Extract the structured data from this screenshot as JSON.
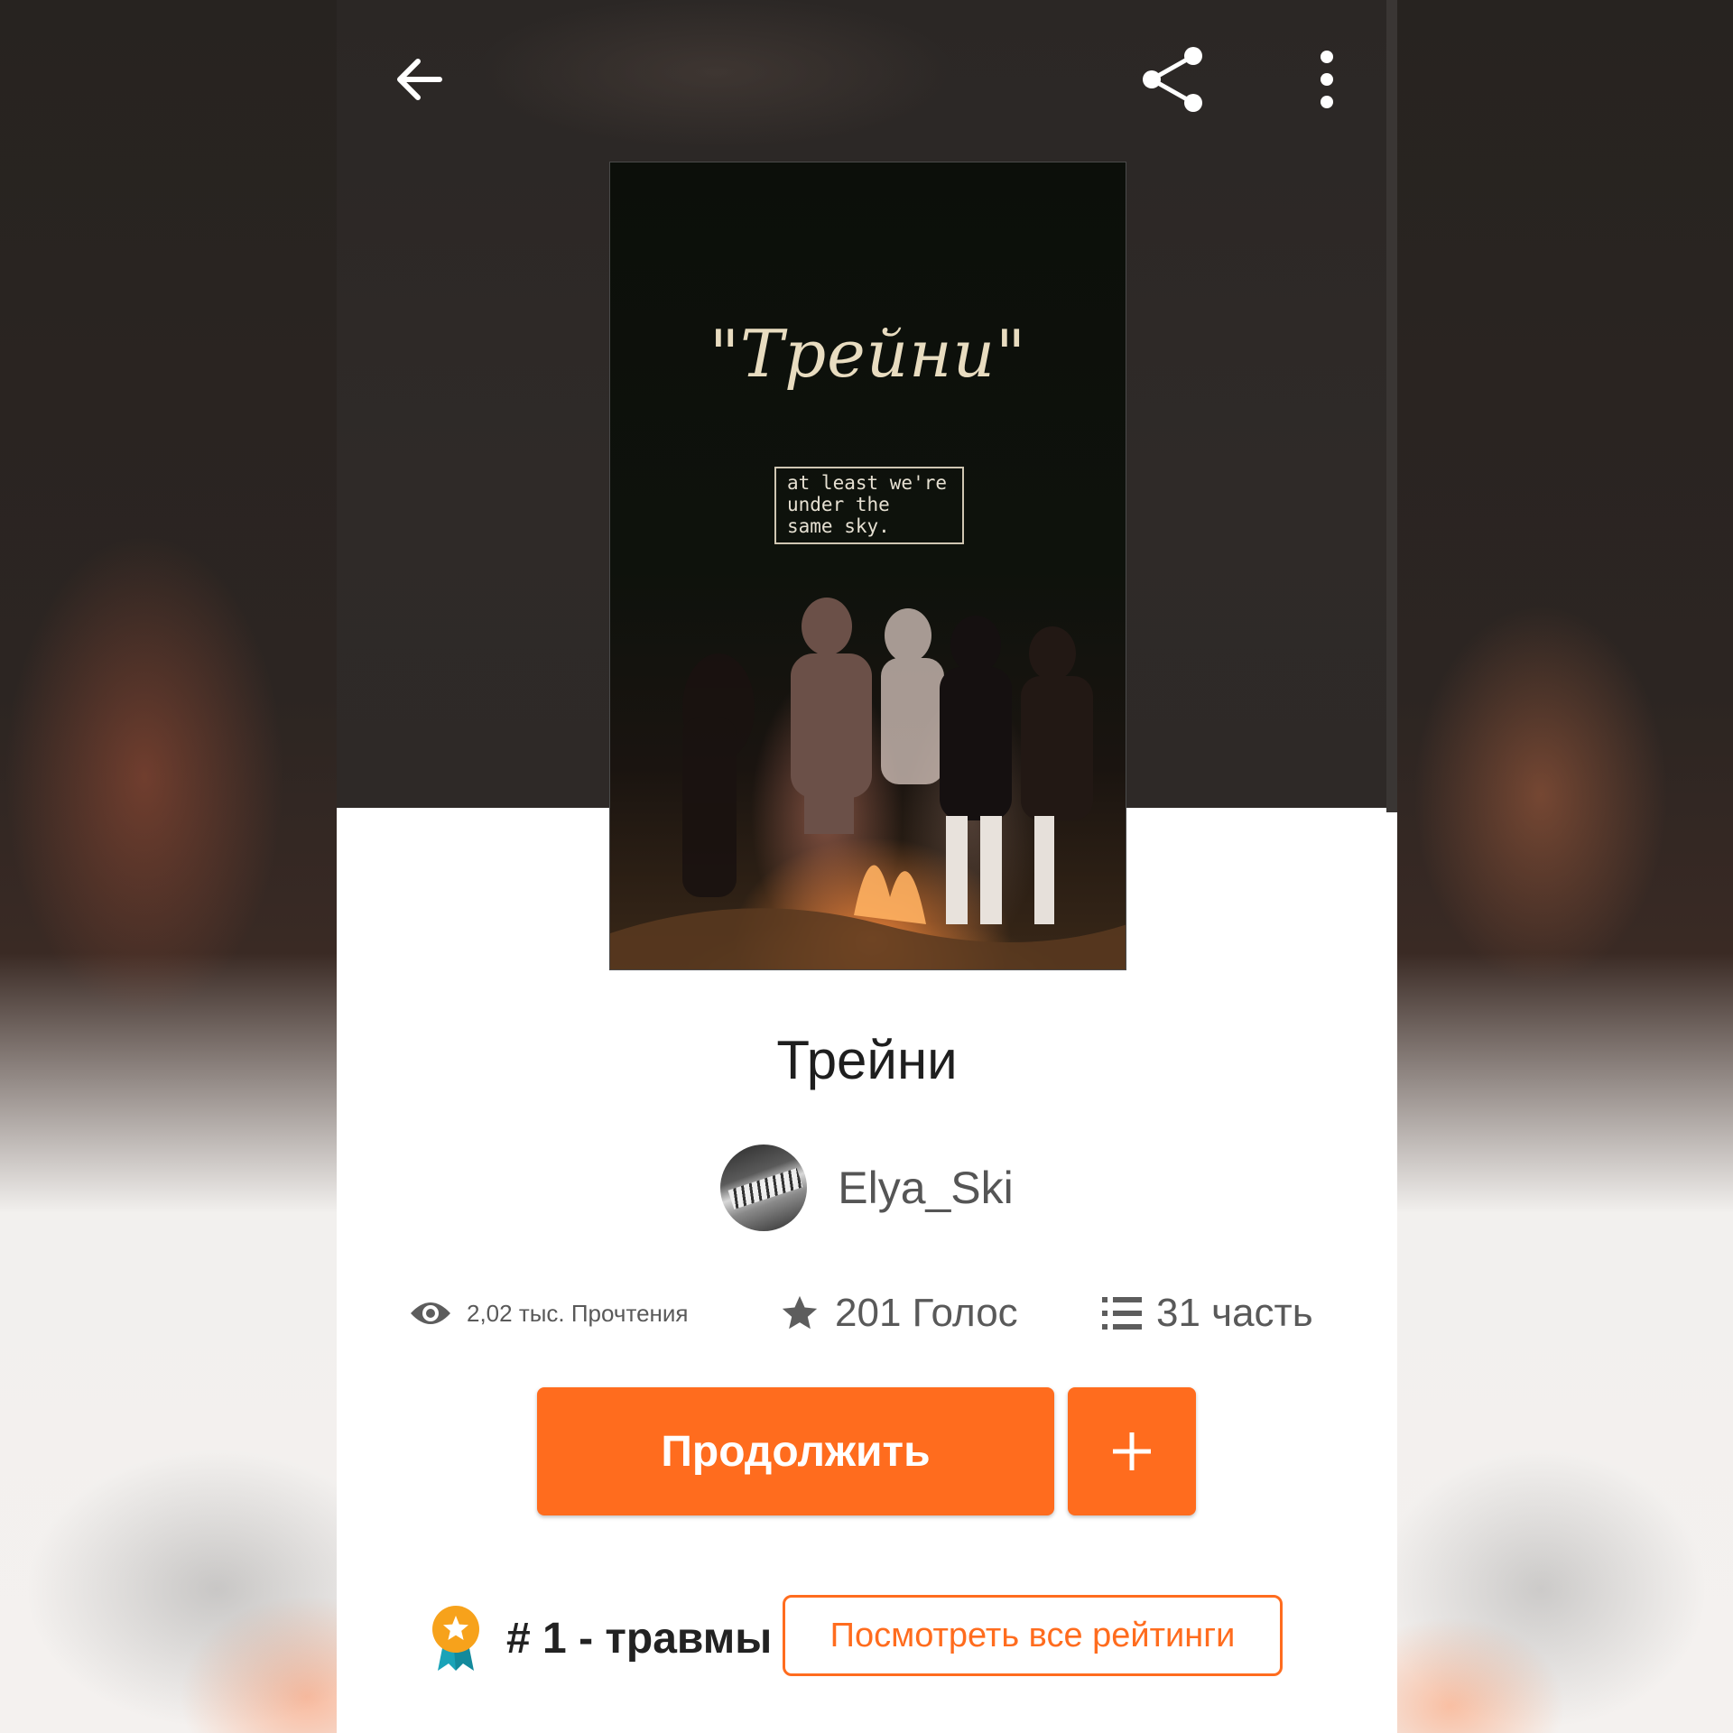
{
  "book": {
    "cover_title": "\"Трейни\"",
    "cover_quote": "at least we're\nunder the\nsame sky.",
    "title": "Трейни"
  },
  "author": {
    "name": "Elya_Ski"
  },
  "stats": {
    "reads": "2,02 тыс. Прочтения",
    "votes": "201 Голос",
    "parts": "31 часть"
  },
  "actions": {
    "continue_label": "Продолжить",
    "view_ratings_label": "Посмотреть все рейтинги"
  },
  "ranking": {
    "text": "# 1 - травмы"
  },
  "icons": {
    "back": "arrow-left-icon",
    "share": "share-icon",
    "more": "more-vertical-icon",
    "eye": "eye-icon",
    "star": "star-icon",
    "list": "list-icon",
    "add": "plus-icon",
    "medal": "medal-icon"
  },
  "colors": {
    "accent": "#ff6c1e",
    "header_bg": "#2b2725",
    "text_dark": "#1e1e1e",
    "text_muted": "#595959"
  }
}
